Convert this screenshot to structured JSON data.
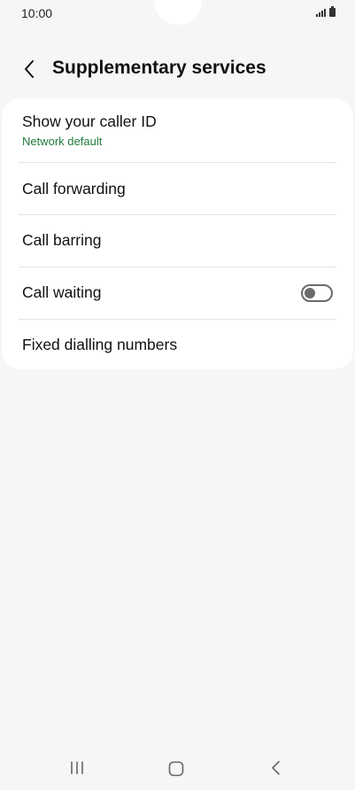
{
  "status_bar": {
    "time": "10:00",
    "icons": [
      "signal-icon",
      "battery-icon"
    ]
  },
  "header": {
    "title": "Supplementary services",
    "back_icon": "chevron-left-icon"
  },
  "settings": {
    "caller_id": {
      "label": "Show your caller ID",
      "value": "Network default",
      "value_color": "#1f7a3a"
    },
    "call_forwarding": {
      "label": "Call forwarding"
    },
    "call_barring": {
      "label": "Call barring"
    },
    "call_waiting": {
      "label": "Call waiting",
      "enabled": false
    },
    "fixed_dialling": {
      "label": "Fixed dialling numbers"
    }
  },
  "nav_bar": {
    "icons": [
      "recent-apps-icon",
      "home-icon",
      "back-icon"
    ]
  }
}
